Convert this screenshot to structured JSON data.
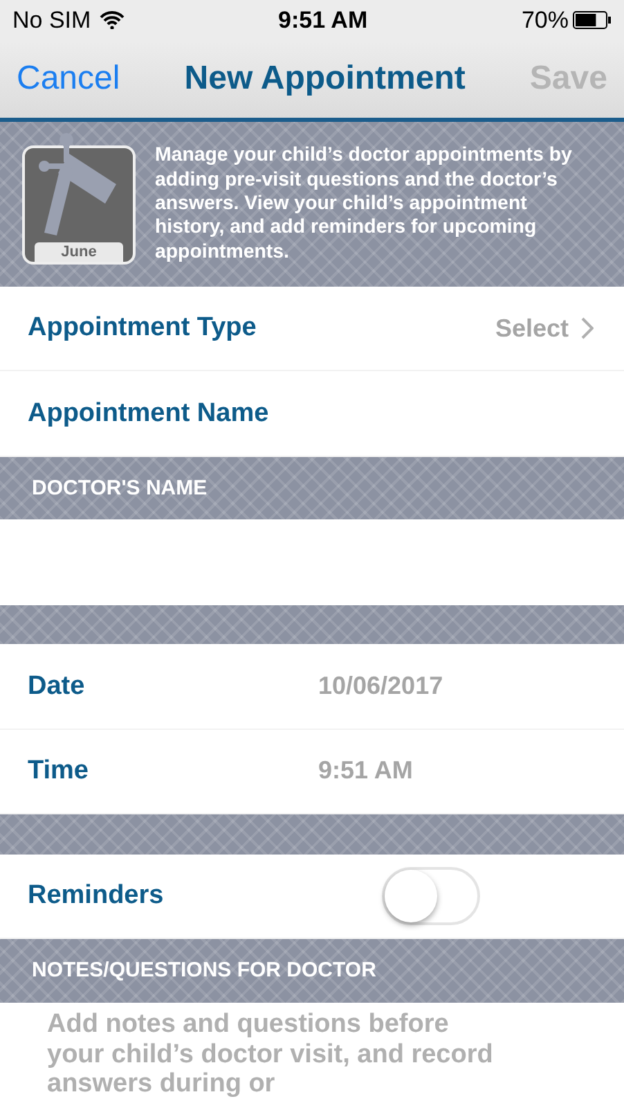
{
  "status_bar": {
    "carrier": "No SIM",
    "time": "9:51 AM",
    "battery": "70%"
  },
  "nav": {
    "cancel": "Cancel",
    "title": "New Appointment",
    "save": "Save",
    "save_disabled": true
  },
  "banner": {
    "icon_label": "June",
    "text": "Manage your child’s doctor appointments by adding pre-visit questions and the doctor’s answers. View your child’s appointment history, and add reminders for upcoming appointments."
  },
  "sections": [
    {
      "kind": "rows",
      "rows": [
        {
          "kind": "select",
          "label": "Appointment Type",
          "value": "Select"
        },
        {
          "kind": "input",
          "label": "Appointment Name"
        }
      ]
    },
    {
      "kind": "header",
      "title": "DOCTOR'S NAME"
    },
    {
      "kind": "field"
    },
    {
      "kind": "spacer"
    },
    {
      "kind": "rows",
      "rows": [
        {
          "kind": "value",
          "label": "Date",
          "value": "10/06/2017"
        },
        {
          "kind": "value",
          "label": "Time",
          "value": "9:51 AM"
        }
      ]
    },
    {
      "kind": "spacer"
    },
    {
      "kind": "rows",
      "rows": [
        {
          "kind": "toggle",
          "label": "Reminders",
          "on": false
        }
      ]
    },
    {
      "kind": "header",
      "title": "NOTES/QUESTIONS FOR DOCTOR"
    },
    {
      "kind": "notes",
      "placeholder": "Add notes and questions before your child’s doctor visit, and record answers during or"
    }
  ]
}
